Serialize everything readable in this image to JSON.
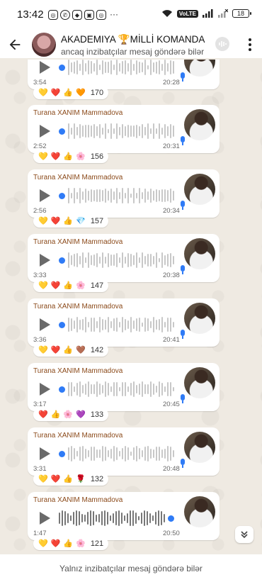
{
  "status_bar": {
    "time": "13:42",
    "volte": "VoLTE",
    "battery": "18"
  },
  "header": {
    "title": "AKADEMIYA 🏆MİLLİ KOMANDA",
    "subtitle": "ancaq inzibatçılar mesaj göndərə bilər"
  },
  "messages": [
    {
      "sender": "",
      "duration": "3:54",
      "time": "20:28",
      "reactions": [
        "💛",
        "❤️",
        "👍",
        "🧡"
      ],
      "count": "170"
    },
    {
      "sender": "Turana XANIM Mammadova",
      "duration": "2:52",
      "time": "20:31",
      "reactions": [
        "💛",
        "❤️",
        "👍",
        "🌸"
      ],
      "count": "156"
    },
    {
      "sender": "Turana XANIM Mammadova",
      "duration": "2:56",
      "time": "20:34",
      "reactions": [
        "💛",
        "❤️",
        "👍",
        "💎"
      ],
      "count": "157"
    },
    {
      "sender": "Turana XANIM Mammadova",
      "duration": "3:33",
      "time": "20:38",
      "reactions": [
        "💛",
        "❤️",
        "👍",
        "🌸"
      ],
      "count": "147"
    },
    {
      "sender": "Turana XANIM Mammadova",
      "duration": "3:36",
      "time": "20:41",
      "reactions": [
        "💛",
        "❤️",
        "👍",
        "🤎"
      ],
      "count": "142"
    },
    {
      "sender": "Turana XANIM Mammadova",
      "duration": "3:17",
      "time": "20:45",
      "reactions": [
        "❤️",
        "👍",
        "🌸",
        "💜"
      ],
      "count": "133"
    },
    {
      "sender": "Turana XANIM Mammadova",
      "duration": "3:31",
      "time": "20:48",
      "reactions": [
        "💛",
        "❤️",
        "👍",
        "🌹"
      ],
      "count": "132"
    },
    {
      "sender": "Turana XANIM Mammadova",
      "duration": "1:47",
      "time": "20:50",
      "reactions": [
        "💛",
        "❤️",
        "👍",
        "🌸"
      ],
      "count": "121"
    }
  ],
  "footer": {
    "text": "Yalnız inzibatçılar mesaj göndərə bilər"
  },
  "colors": {
    "accent_blue": "#2f7bf6",
    "sender_name": "#8b4a1a",
    "chat_background": "#efeae2"
  }
}
